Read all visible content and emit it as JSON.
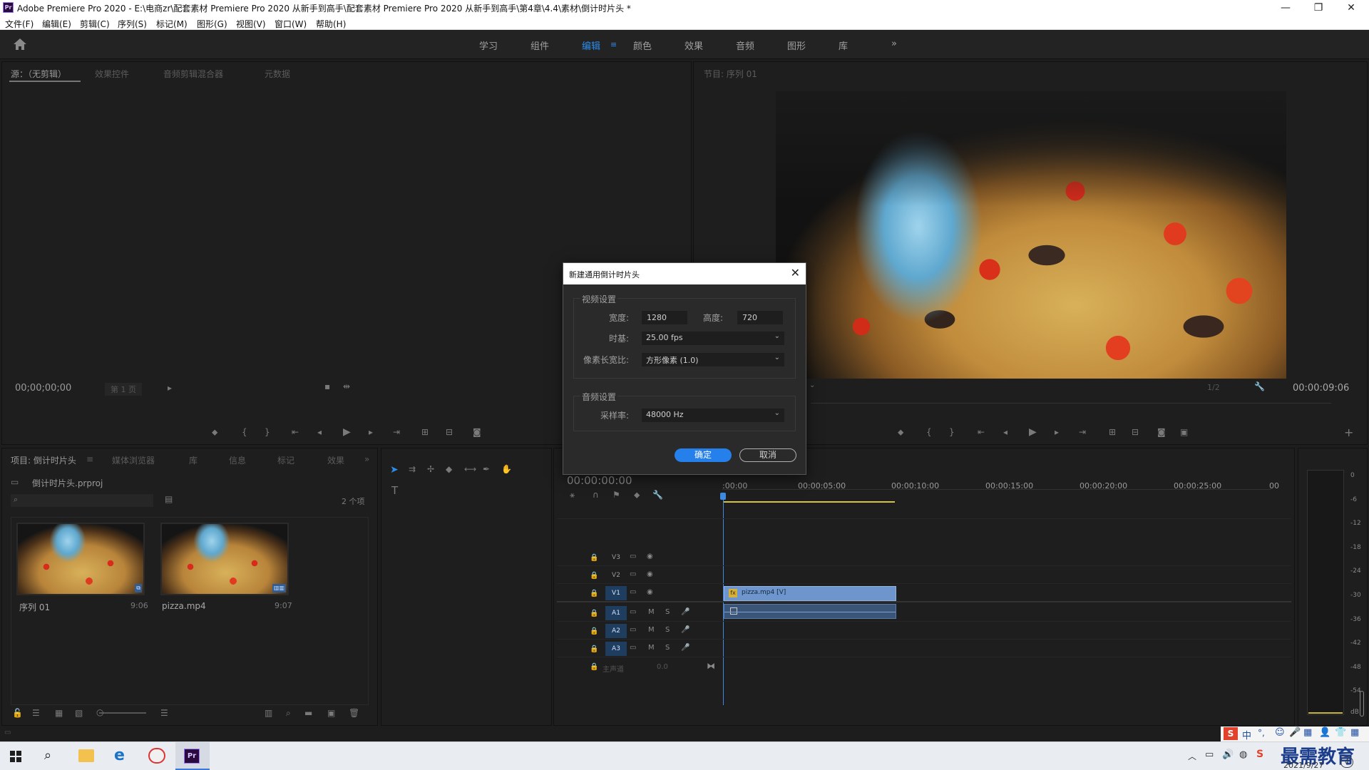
{
  "window": {
    "title": "Adobe Premiere Pro 2020 - E:\\电商zr\\配套素材 Premiere Pro 2020 从新手到高手\\配套素材 Premiere Pro 2020 从新手到高手\\第4章\\4.4\\素材\\倒计时片头 *",
    "logo": "Pr"
  },
  "menu": [
    "文件(F)",
    "编辑(E)",
    "剪辑(C)",
    "序列(S)",
    "标记(M)",
    "图形(G)",
    "视图(V)",
    "窗口(W)",
    "帮助(H)"
  ],
  "workspaces": {
    "tabs": [
      "学习",
      "组件",
      "编辑",
      "颜色",
      "效果",
      "音频",
      "图形",
      "库"
    ],
    "active": "编辑",
    "more": "»"
  },
  "source_panel": {
    "tabs": [
      "源：（无剪辑）",
      "效果控件",
      "音频剪辑混合器",
      "元数据"
    ],
    "timecode": "00;00;00;00",
    "page": "第 1 页"
  },
  "program_panel": {
    "tab": "节目: 序列 01",
    "timecode": "00:00:09:06",
    "zoom": "1/2",
    "plus": "+"
  },
  "dialog": {
    "title": "新建通用倒计时片头",
    "video_group": "视频设置",
    "width_label": "宽度:",
    "width_value": "1280",
    "height_label": "高度:",
    "height_value": "720",
    "timebase_label": "时基:",
    "timebase_value": "25.00 fps",
    "par_label": "像素长宽比:",
    "par_value": "方形像素 (1.0)",
    "audio_group": "音频设置",
    "samplerate_label": "采样率:",
    "samplerate_value": "48000 Hz",
    "ok": "确定",
    "cancel": "取消"
  },
  "project_panel": {
    "tabs": [
      "项目: 倒计时片头",
      "媒体浏览器",
      "库",
      "信息",
      "标记",
      "效果"
    ],
    "file": "倒计时片头.prproj",
    "count": "2 个项",
    "items": [
      {
        "name": "序列 01",
        "duration": "9:06"
      },
      {
        "name": "pizza.mp4",
        "duration": "9:07"
      }
    ]
  },
  "timeline": {
    "timecode": "00:00:00:00",
    "ruler": [
      ":00:00",
      "00:00:05:00",
      "00:00:10:00",
      "00:00:15:00",
      "00:00:20:00",
      "00:00:25:00",
      "00"
    ],
    "tracks": [
      "V3",
      "V2",
      "V1",
      "A1",
      "A2",
      "A3"
    ],
    "master": "主声道",
    "master_value": "0.0",
    "clip": "pizza.mp4 [V]",
    "fx": "fx"
  },
  "meter": {
    "labels": [
      "0",
      "-6",
      "-12",
      "-18",
      "-24",
      "-30",
      "-36",
      "-42",
      "-48",
      "-54",
      "dB"
    ]
  },
  "taskbar": {
    "date": "2021/9/27",
    "watermark": "最需教育",
    "ime": "中",
    "app": "Pr"
  },
  "colors": {
    "accent": "#2d8ceb",
    "clip_video": "#6e96cc",
    "ok_button": "#2680eb"
  }
}
